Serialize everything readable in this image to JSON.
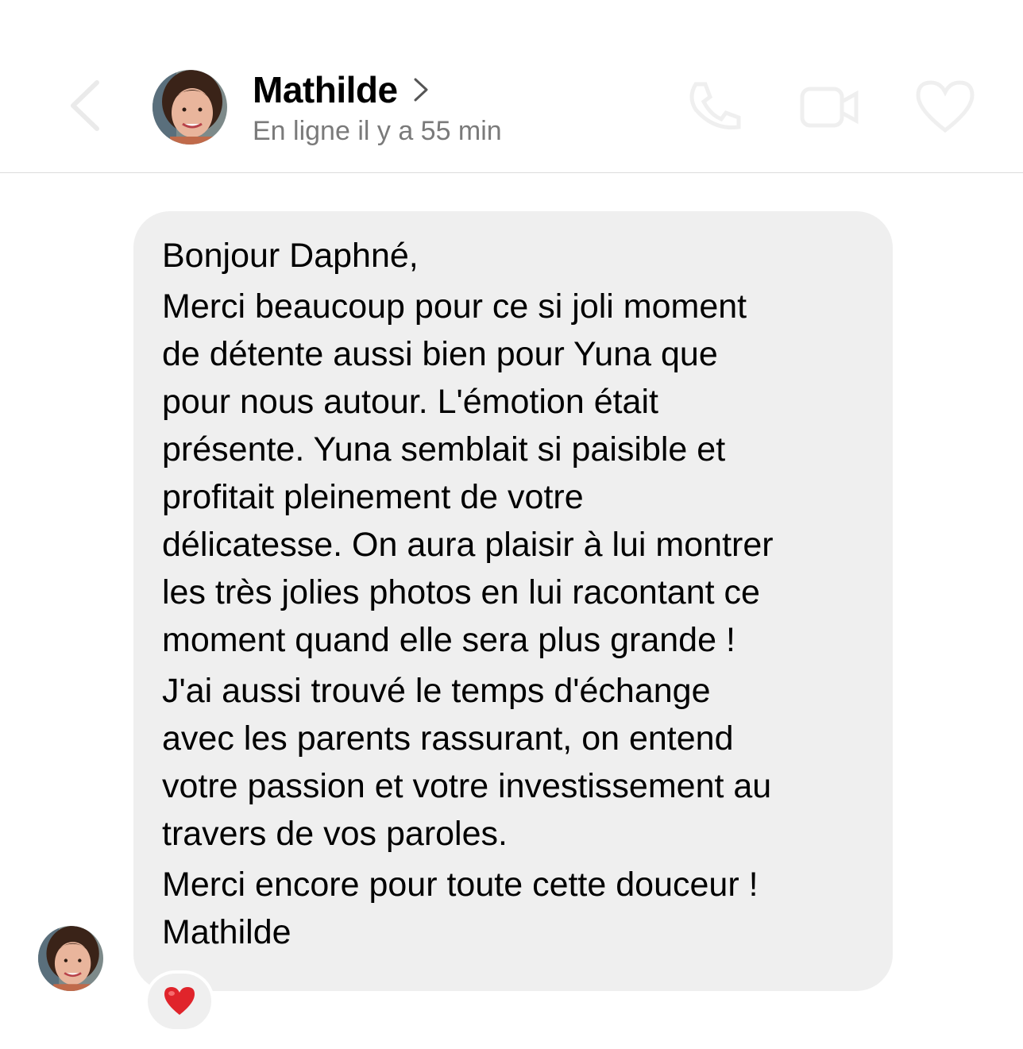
{
  "header": {
    "contact_name": "Mathilde",
    "status": "En ligne il y a 55 min"
  },
  "icons": {
    "back": "chevron-left-icon",
    "profile_link": "chevron-right-icon",
    "call": "phone-icon",
    "video": "video-camera-icon",
    "like": "heart-outline-icon",
    "reaction": "red-heart-emoji"
  },
  "message": {
    "paragraphs": [
      [
        "Bonjour Daphné,"
      ],
      [
        "Merci beaucoup pour ce si joli moment",
        "de détente aussi bien pour Yuna que",
        "pour nous autour. L'émotion était",
        "présente. Yuna semblait si paisible et",
        "profitait pleinement de votre",
        "délicatesse. On aura plaisir à lui montrer",
        "les très jolies photos en lui racontant ce",
        "moment quand elle sera plus grande !"
      ],
      [
        "J'ai aussi trouvé le temps d'échange",
        "avec les parents rassurant, on entend",
        "votre passion et votre investissement au",
        "travers de vos paroles."
      ],
      [
        "Merci encore pour toute cette douceur !",
        "Mathilde"
      ]
    ],
    "reaction": "❤️"
  },
  "colors": {
    "bubble": "#efefef",
    "status_text": "#7a7a7a",
    "divider": "#dcdcdc",
    "heart": "#e0242b"
  }
}
